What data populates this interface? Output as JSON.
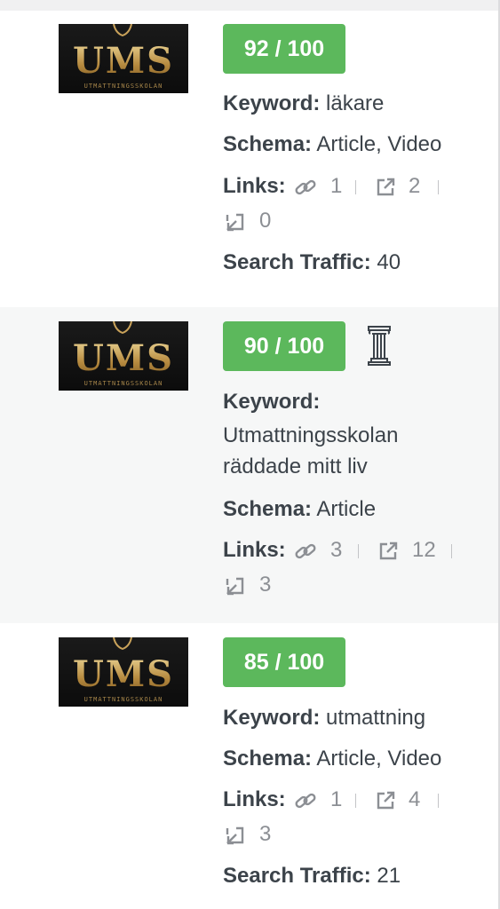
{
  "items": [
    {
      "logo": {
        "text": "UMS",
        "subtext": "UTMATTNINGSSKOLAN"
      },
      "score": "92 / 100",
      "has_pillar": false,
      "keyword_label": "Keyword:",
      "keyword_line1": "läkare",
      "keyword_line2": "",
      "keyword_line3": "",
      "schema_label": "Schema:",
      "schema_value": "Article, Video",
      "links_label": "Links:",
      "internal_links": "1",
      "external_links": "2",
      "incoming_links": "0",
      "traffic_label": "Search Traffic:",
      "traffic_value": "40"
    },
    {
      "logo": {
        "text": "UMS",
        "subtext": "UTMATTNINGSSKOLAN"
      },
      "score": "90 / 100",
      "has_pillar": true,
      "keyword_label": "Keyword:",
      "keyword_line1": "",
      "keyword_line2": "Utmattningsskolan",
      "keyword_line3": "räddade mitt liv",
      "schema_label": "Schema:",
      "schema_value": "Article",
      "links_label": "Links:",
      "internal_links": "3",
      "external_links": "12",
      "incoming_links": "3",
      "traffic_label": "",
      "traffic_value": ""
    },
    {
      "logo": {
        "text": "UMS",
        "subtext": "UTMATTNINGSSKOLAN"
      },
      "score": "85 / 100",
      "has_pillar": false,
      "keyword_label": "Keyword:",
      "keyword_line1": "utmattning",
      "keyword_line2": "",
      "keyword_line3": "",
      "schema_label": "Schema:",
      "schema_value": "Article, Video",
      "links_label": "Links:",
      "internal_links": "1",
      "external_links": "4",
      "incoming_links": "3",
      "traffic_label": "Search Traffic:",
      "traffic_value": "21"
    }
  ],
  "icons": {
    "internal": "link-icon",
    "external": "external-link-icon",
    "incoming": "incoming-link-icon",
    "pillar": "pillar-content-icon"
  },
  "colors": {
    "score_bg": "#5cb85c",
    "alt_row_bg": "#f6f7f7",
    "text": "#3c434a",
    "muted": "#8c8f94"
  }
}
